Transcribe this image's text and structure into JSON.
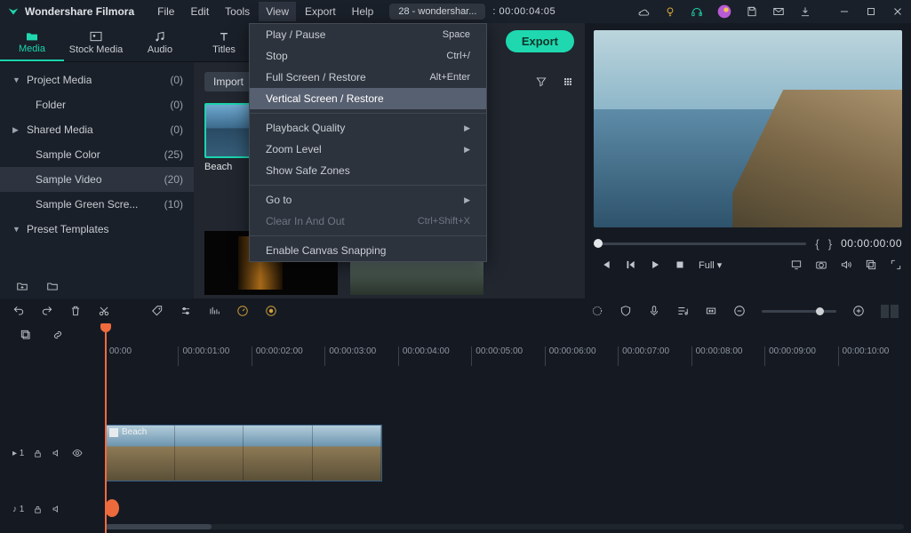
{
  "app": {
    "brand": "Wondershare Filmora"
  },
  "menu": {
    "file": "File",
    "edit": "Edit",
    "tools": "Tools",
    "view": "View",
    "export": "Export",
    "help": "Help",
    "tab": "28 - wondershar...",
    "tab_tc": ": 00:00:04:05"
  },
  "dropdown": {
    "play": "Play / Pause",
    "play_s": "Space",
    "stop": "Stop",
    "stop_s": "Ctrl+/",
    "full": "Full Screen / Restore",
    "full_s": "Alt+Enter",
    "vert": "Vertical Screen / Restore",
    "pq": "Playback Quality",
    "zl": "Zoom Level",
    "safe": "Show Safe Zones",
    "goto": "Go to",
    "clear": "Clear In And Out",
    "clear_s": "Ctrl+Shift+X",
    "snap": "Enable Canvas Snapping"
  },
  "tabs": {
    "media": "Media",
    "stock": "Stock Media",
    "audio": "Audio",
    "titles": "Titles"
  },
  "tree": {
    "pm": {
      "label": "Project Media",
      "count": "(0)"
    },
    "folder": {
      "label": "Folder",
      "count": "(0)"
    },
    "sm": {
      "label": "Shared Media",
      "count": "(0)"
    },
    "sc": {
      "label": "Sample Color",
      "count": "(25)"
    },
    "sv": {
      "label": "Sample Video",
      "count": "(20)"
    },
    "sg": {
      "label": "Sample Green Scre...",
      "count": "(10)"
    },
    "pt": {
      "label": "Preset Templates"
    }
  },
  "center": {
    "import": "Import",
    "thumb": "Beach"
  },
  "export_btn": "Export",
  "preview": {
    "tc": "00:00:00:00",
    "fit": "Full"
  },
  "ruler": [
    "00:00",
    "00:00:01:00",
    "00:00:02:00",
    "00:00:03:00",
    "00:00:04:00",
    "00:00:05:00",
    "00:00:06:00",
    "00:00:07:00",
    "00:00:08:00",
    "00:00:09:00",
    "00:00:10:00"
  ],
  "clip": {
    "title": "Beach"
  },
  "audio_label": "♪ 1",
  "video_label": "▸ 1"
}
